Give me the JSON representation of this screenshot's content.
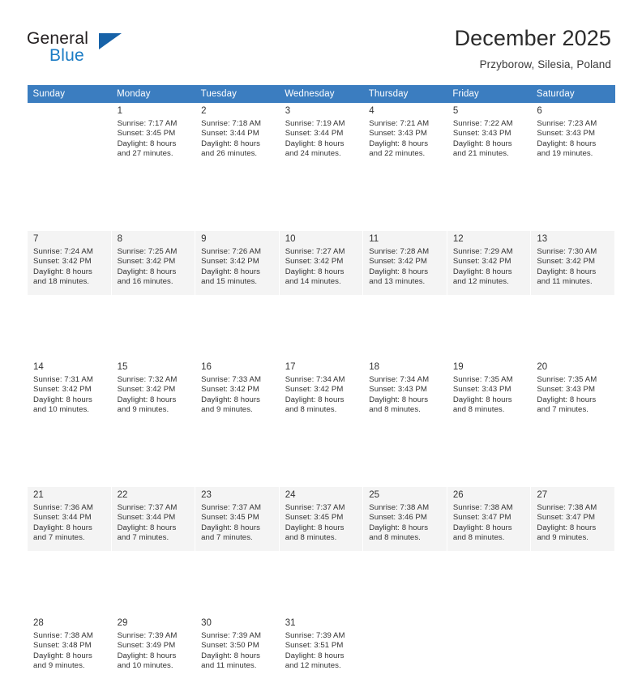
{
  "brand": {
    "name_part1": "General",
    "name_part2": "Blue",
    "logo_icon": "triangle-logo-icon",
    "accent_color": "#1a7bc4"
  },
  "header": {
    "title": "December 2025",
    "location": "Przyborow, Silesia, Poland"
  },
  "calendar": {
    "header_bg_color": "#3b7dc0",
    "weekday_headers": [
      "Sunday",
      "Monday",
      "Tuesday",
      "Wednesday",
      "Thursday",
      "Friday",
      "Saturday"
    ],
    "weeks": [
      {
        "shade": "odd",
        "days": [
          {
            "num": "",
            "sunrise": "",
            "sunset": "",
            "daylight_line1": "",
            "daylight_line2": ""
          },
          {
            "num": "1",
            "sunrise": "Sunrise: 7:17 AM",
            "sunset": "Sunset: 3:45 PM",
            "daylight_line1": "Daylight: 8 hours",
            "daylight_line2": "and 27 minutes."
          },
          {
            "num": "2",
            "sunrise": "Sunrise: 7:18 AM",
            "sunset": "Sunset: 3:44 PM",
            "daylight_line1": "Daylight: 8 hours",
            "daylight_line2": "and 26 minutes."
          },
          {
            "num": "3",
            "sunrise": "Sunrise: 7:19 AM",
            "sunset": "Sunset: 3:44 PM",
            "daylight_line1": "Daylight: 8 hours",
            "daylight_line2": "and 24 minutes."
          },
          {
            "num": "4",
            "sunrise": "Sunrise: 7:21 AM",
            "sunset": "Sunset: 3:43 PM",
            "daylight_line1": "Daylight: 8 hours",
            "daylight_line2": "and 22 minutes."
          },
          {
            "num": "5",
            "sunrise": "Sunrise: 7:22 AM",
            "sunset": "Sunset: 3:43 PM",
            "daylight_line1": "Daylight: 8 hours",
            "daylight_line2": "and 21 minutes."
          },
          {
            "num": "6",
            "sunrise": "Sunrise: 7:23 AM",
            "sunset": "Sunset: 3:43 PM",
            "daylight_line1": "Daylight: 8 hours",
            "daylight_line2": "and 19 minutes."
          }
        ]
      },
      {
        "shade": "even",
        "days": [
          {
            "num": "7",
            "sunrise": "Sunrise: 7:24 AM",
            "sunset": "Sunset: 3:42 PM",
            "daylight_line1": "Daylight: 8 hours",
            "daylight_line2": "and 18 minutes."
          },
          {
            "num": "8",
            "sunrise": "Sunrise: 7:25 AM",
            "sunset": "Sunset: 3:42 PM",
            "daylight_line1": "Daylight: 8 hours",
            "daylight_line2": "and 16 minutes."
          },
          {
            "num": "9",
            "sunrise": "Sunrise: 7:26 AM",
            "sunset": "Sunset: 3:42 PM",
            "daylight_line1": "Daylight: 8 hours",
            "daylight_line2": "and 15 minutes."
          },
          {
            "num": "10",
            "sunrise": "Sunrise: 7:27 AM",
            "sunset": "Sunset: 3:42 PM",
            "daylight_line1": "Daylight: 8 hours",
            "daylight_line2": "and 14 minutes."
          },
          {
            "num": "11",
            "sunrise": "Sunrise: 7:28 AM",
            "sunset": "Sunset: 3:42 PM",
            "daylight_line1": "Daylight: 8 hours",
            "daylight_line2": "and 13 minutes."
          },
          {
            "num": "12",
            "sunrise": "Sunrise: 7:29 AM",
            "sunset": "Sunset: 3:42 PM",
            "daylight_line1": "Daylight: 8 hours",
            "daylight_line2": "and 12 minutes."
          },
          {
            "num": "13",
            "sunrise": "Sunrise: 7:30 AM",
            "sunset": "Sunset: 3:42 PM",
            "daylight_line1": "Daylight: 8 hours",
            "daylight_line2": "and 11 minutes."
          }
        ]
      },
      {
        "shade": "odd",
        "days": [
          {
            "num": "14",
            "sunrise": "Sunrise: 7:31 AM",
            "sunset": "Sunset: 3:42 PM",
            "daylight_line1": "Daylight: 8 hours",
            "daylight_line2": "and 10 minutes."
          },
          {
            "num": "15",
            "sunrise": "Sunrise: 7:32 AM",
            "sunset": "Sunset: 3:42 PM",
            "daylight_line1": "Daylight: 8 hours",
            "daylight_line2": "and 9 minutes."
          },
          {
            "num": "16",
            "sunrise": "Sunrise: 7:33 AM",
            "sunset": "Sunset: 3:42 PM",
            "daylight_line1": "Daylight: 8 hours",
            "daylight_line2": "and 9 minutes."
          },
          {
            "num": "17",
            "sunrise": "Sunrise: 7:34 AM",
            "sunset": "Sunset: 3:42 PM",
            "daylight_line1": "Daylight: 8 hours",
            "daylight_line2": "and 8 minutes."
          },
          {
            "num": "18",
            "sunrise": "Sunrise: 7:34 AM",
            "sunset": "Sunset: 3:43 PM",
            "daylight_line1": "Daylight: 8 hours",
            "daylight_line2": "and 8 minutes."
          },
          {
            "num": "19",
            "sunrise": "Sunrise: 7:35 AM",
            "sunset": "Sunset: 3:43 PM",
            "daylight_line1": "Daylight: 8 hours",
            "daylight_line2": "and 8 minutes."
          },
          {
            "num": "20",
            "sunrise": "Sunrise: 7:35 AM",
            "sunset": "Sunset: 3:43 PM",
            "daylight_line1": "Daylight: 8 hours",
            "daylight_line2": "and 7 minutes."
          }
        ]
      },
      {
        "shade": "even",
        "days": [
          {
            "num": "21",
            "sunrise": "Sunrise: 7:36 AM",
            "sunset": "Sunset: 3:44 PM",
            "daylight_line1": "Daylight: 8 hours",
            "daylight_line2": "and 7 minutes."
          },
          {
            "num": "22",
            "sunrise": "Sunrise: 7:37 AM",
            "sunset": "Sunset: 3:44 PM",
            "daylight_line1": "Daylight: 8 hours",
            "daylight_line2": "and 7 minutes."
          },
          {
            "num": "23",
            "sunrise": "Sunrise: 7:37 AM",
            "sunset": "Sunset: 3:45 PM",
            "daylight_line1": "Daylight: 8 hours",
            "daylight_line2": "and 7 minutes."
          },
          {
            "num": "24",
            "sunrise": "Sunrise: 7:37 AM",
            "sunset": "Sunset: 3:45 PM",
            "daylight_line1": "Daylight: 8 hours",
            "daylight_line2": "and 8 minutes."
          },
          {
            "num": "25",
            "sunrise": "Sunrise: 7:38 AM",
            "sunset": "Sunset: 3:46 PM",
            "daylight_line1": "Daylight: 8 hours",
            "daylight_line2": "and 8 minutes."
          },
          {
            "num": "26",
            "sunrise": "Sunrise: 7:38 AM",
            "sunset": "Sunset: 3:47 PM",
            "daylight_line1": "Daylight: 8 hours",
            "daylight_line2": "and 8 minutes."
          },
          {
            "num": "27",
            "sunrise": "Sunrise: 7:38 AM",
            "sunset": "Sunset: 3:47 PM",
            "daylight_line1": "Daylight: 8 hours",
            "daylight_line2": "and 9 minutes."
          }
        ]
      },
      {
        "shade": "odd",
        "days": [
          {
            "num": "28",
            "sunrise": "Sunrise: 7:38 AM",
            "sunset": "Sunset: 3:48 PM",
            "daylight_line1": "Daylight: 8 hours",
            "daylight_line2": "and 9 minutes."
          },
          {
            "num": "29",
            "sunrise": "Sunrise: 7:39 AM",
            "sunset": "Sunset: 3:49 PM",
            "daylight_line1": "Daylight: 8 hours",
            "daylight_line2": "and 10 minutes."
          },
          {
            "num": "30",
            "sunrise": "Sunrise: 7:39 AM",
            "sunset": "Sunset: 3:50 PM",
            "daylight_line1": "Daylight: 8 hours",
            "daylight_line2": "and 11 minutes."
          },
          {
            "num": "31",
            "sunrise": "Sunrise: 7:39 AM",
            "sunset": "Sunset: 3:51 PM",
            "daylight_line1": "Daylight: 8 hours",
            "daylight_line2": "and 12 minutes."
          },
          {
            "num": "",
            "sunrise": "",
            "sunset": "",
            "daylight_line1": "",
            "daylight_line2": ""
          },
          {
            "num": "",
            "sunrise": "",
            "sunset": "",
            "daylight_line1": "",
            "daylight_line2": ""
          },
          {
            "num": "",
            "sunrise": "",
            "sunset": "",
            "daylight_line1": "",
            "daylight_line2": ""
          }
        ]
      }
    ]
  }
}
